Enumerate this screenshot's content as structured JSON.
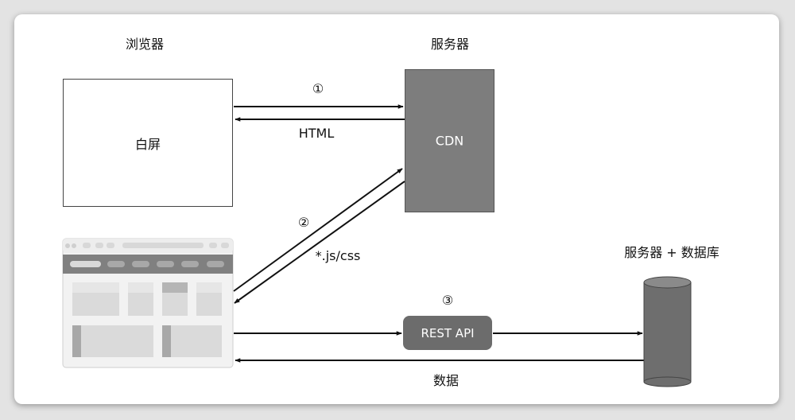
{
  "labels": {
    "browser": "浏览器",
    "server": "服务器",
    "server_db": "服务器 + 数据库",
    "white_screen": "白屏",
    "cdn": "CDN",
    "rest_api": "REST API",
    "step1": "①",
    "step2": "②",
    "step3": "③",
    "html": "HTML",
    "js_css": "*.js/css",
    "data": "数据"
  },
  "colors": {
    "cdn_fill": "#7d7d7d",
    "api_fill": "#6c6c6c",
    "db_fill": "#6e6e6e",
    "arrow": "#111111"
  },
  "icons": {
    "browser_mockup": "browser-window-icon",
    "database": "database-cylinder-icon"
  }
}
